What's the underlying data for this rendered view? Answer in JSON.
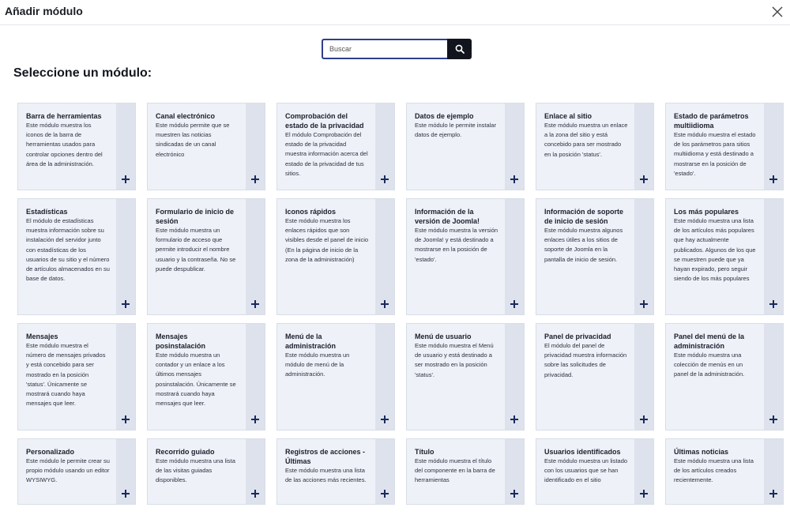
{
  "modal": {
    "title": "Añadir módulo",
    "close_icon": "close-icon"
  },
  "search": {
    "placeholder": "Buscar",
    "button_icon": "search-icon"
  },
  "heading": "Seleccione un módulo:",
  "colors": {
    "card_bg": "#eef1f7",
    "card_strip": "#dde2ed",
    "search_border": "#2f3f8a",
    "search_button": "#11141c"
  },
  "rows": [
    [
      {
        "title": "Barra de herramientas",
        "description": "Este módulo muestra los iconos de la barra de herramientas usados para controlar opciones dentro del área de la administración."
      },
      {
        "title": "Canal electrónico",
        "description": "Este módulo permite que se muestren las noticias sindicadas de un canal electrónico"
      },
      {
        "title": "Comprobación del estado de la privacidad",
        "description": "El módulo Comprobación del estado de la privacidad muestra información acerca del estado de la privacidad de tus sitios."
      },
      {
        "title": "Datos de ejemplo",
        "description": "Este módulo le permite instalar datos de ejemplo."
      },
      {
        "title": "Enlace al sitio",
        "description": "Este módulo muestra un enlace a la zona del sitio y está concebido para ser mostrado en la posición 'status'."
      },
      {
        "title": "Estado de parámetros multiidioma",
        "description": "Este módulo muestra el estado de los parámetros para sitios multiidioma y está destinado a mostrarse en la posición de 'estado'."
      }
    ],
    [
      {
        "title": "Estadísticas",
        "description": "El módulo de estadísticas muestra información sobre su instalación del servidor junto con estadísticas de los usuarios de su sitio y el número de artículos almacenados en su base de datos."
      },
      {
        "title": "Formulario de inicio de sesión",
        "description": "Este módulo muestra un formulario de acceso que permite introducir el nombre usuario y la contraseña. No se puede despublicar."
      },
      {
        "title": "Iconos rápidos",
        "description": "Este módulo muestra los enlaces rápidos que son visibles desde el panel de inicio (En la página de inicio de la zona de la administración)"
      },
      {
        "title": "Información de la versión de Joomla!",
        "description": "Este módulo muestra la versión de Joomla! y está destinado a mostrarse en la posición de 'estado'."
      },
      {
        "title": "Información de soporte de inicio de sesión",
        "description": "Este módulo muestra algunos enlaces útiles a los sitios de soporte de Joomla en la pantalla de inicio de sesión."
      },
      {
        "title": "Los más populares",
        "description": "Este módulo muestra una lista de los artículos más populares que hay actualmente publicados. Algunos de los que se muestren puede que ya hayan expirado, pero seguir siendo de los más populares"
      }
    ],
    [
      {
        "title": "Mensajes",
        "description": "Este módulo muestra el número de mensajes privados y está concebido para ser mostrado en la posición 'status'. Únicamente se mostrará cuando haya mensajes que leer."
      },
      {
        "title": "Mensajes posinstalación",
        "description": "Este módulo muestra un contador y un enlace a los últimos mensajes posinstalación. Únicamente se mostrará cuando haya mensajes que leer."
      },
      {
        "title": "Menú de la administración",
        "description": "Este módulo muestra un módulo de menú de la administración."
      },
      {
        "title": "Menú de usuario",
        "description": "Este módulo muestra el Menú de usuario y está destinado a ser mostrado en la posición 'status'."
      },
      {
        "title": "Panel de privacidad",
        "description": "El módulo del panel de privacidad muestra información sobre las solicitudes de privacidad."
      },
      {
        "title": "Panel del menú de la administración",
        "description": "Este módulo muestra una colección de menús en un panel de la administración."
      }
    ],
    [
      {
        "title": "Personalizado",
        "description": "Este módulo le permite crear su propio módulo usando un editor WYSIWYG."
      },
      {
        "title": "Recorrido guiado",
        "description": "Este módulo muestra una lista de las visitas guiadas disponibles."
      },
      {
        "title": "Registros de acciones - Últimas",
        "description": "Este módulo muestra una lista de las acciones más recientes."
      },
      {
        "title": "Título",
        "description": "Este módulo muestra el título del componente en la barra de herramientas"
      },
      {
        "title": "Usuarios identificados",
        "description": "Este módulo muestra un listado con los usuarios que se han identificado en el sitio"
      },
      {
        "title": "Últimas noticias",
        "description": "Este módulo muestra una lista de los artículos creados recientemente."
      }
    ]
  ],
  "card_add_icon": "plus-icon"
}
